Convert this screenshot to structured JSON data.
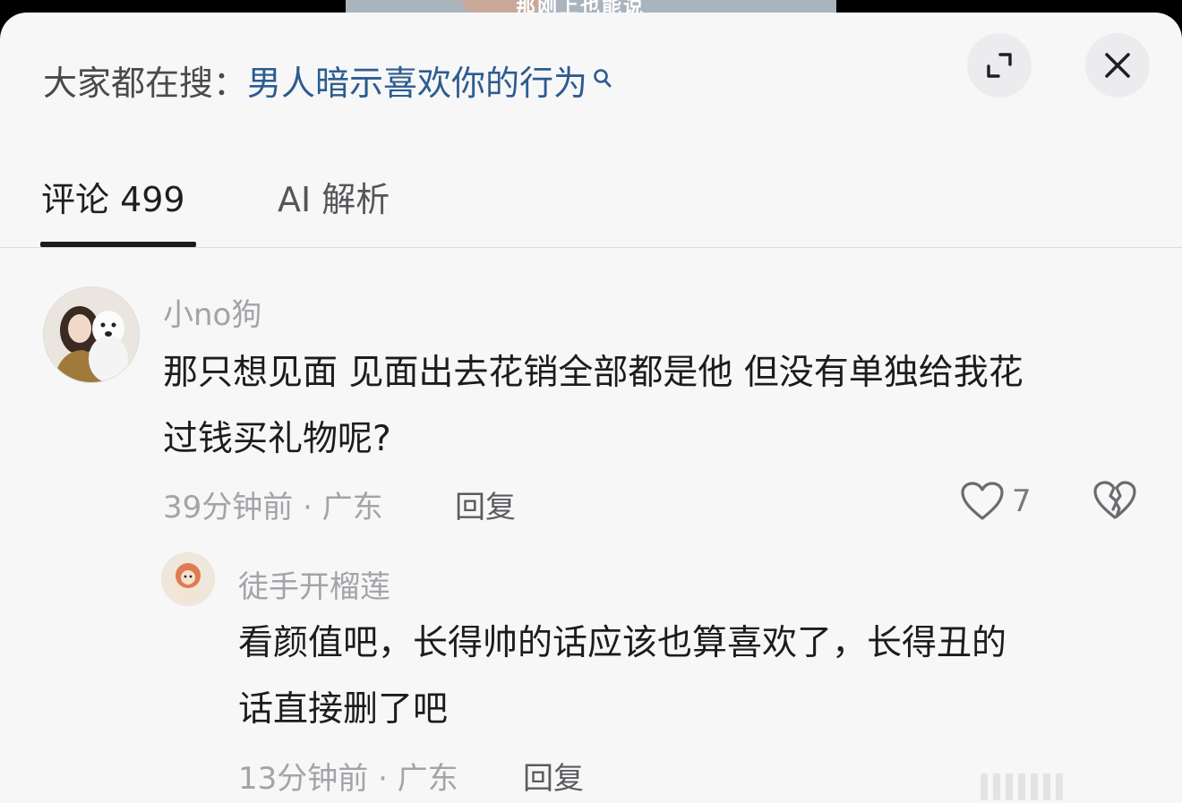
{
  "video": {
    "caption": "那刚上也能说"
  },
  "header": {
    "search_prefix": "大家都在搜：",
    "search_query": "男人暗示喜欢你的行为",
    "search_icon": "search-icon",
    "expand_icon": "expand-icon",
    "close_icon": "close-icon"
  },
  "tabs": [
    {
      "label": "评论 499",
      "active": true
    },
    {
      "label": "AI 解析",
      "active": false
    }
  ],
  "comments": [
    {
      "username": "小no狗",
      "text_lines": [
        "那只想见面 见面出去花销全部都是他 但没有单独给我花",
        "过钱买礼物呢?"
      ],
      "meta": "39分钟前 · 广东",
      "reply_label": "回复",
      "likes": "7",
      "like_icon": "heart-outline-icon",
      "dislike_icon": "broken-heart-icon"
    },
    {
      "username": "徒手开榴莲",
      "text_lines": [
        "看颜值吧，长得帅的话应该也算喜欢了，长得丑的",
        "话直接删了吧"
      ],
      "meta": "13分钟前 · 广东",
      "reply_label": "回复"
    }
  ],
  "colors": {
    "search_query": "#2d5c8f",
    "sheet_bg": "#f7f7f8",
    "muted_text": "#a3a3a8"
  }
}
